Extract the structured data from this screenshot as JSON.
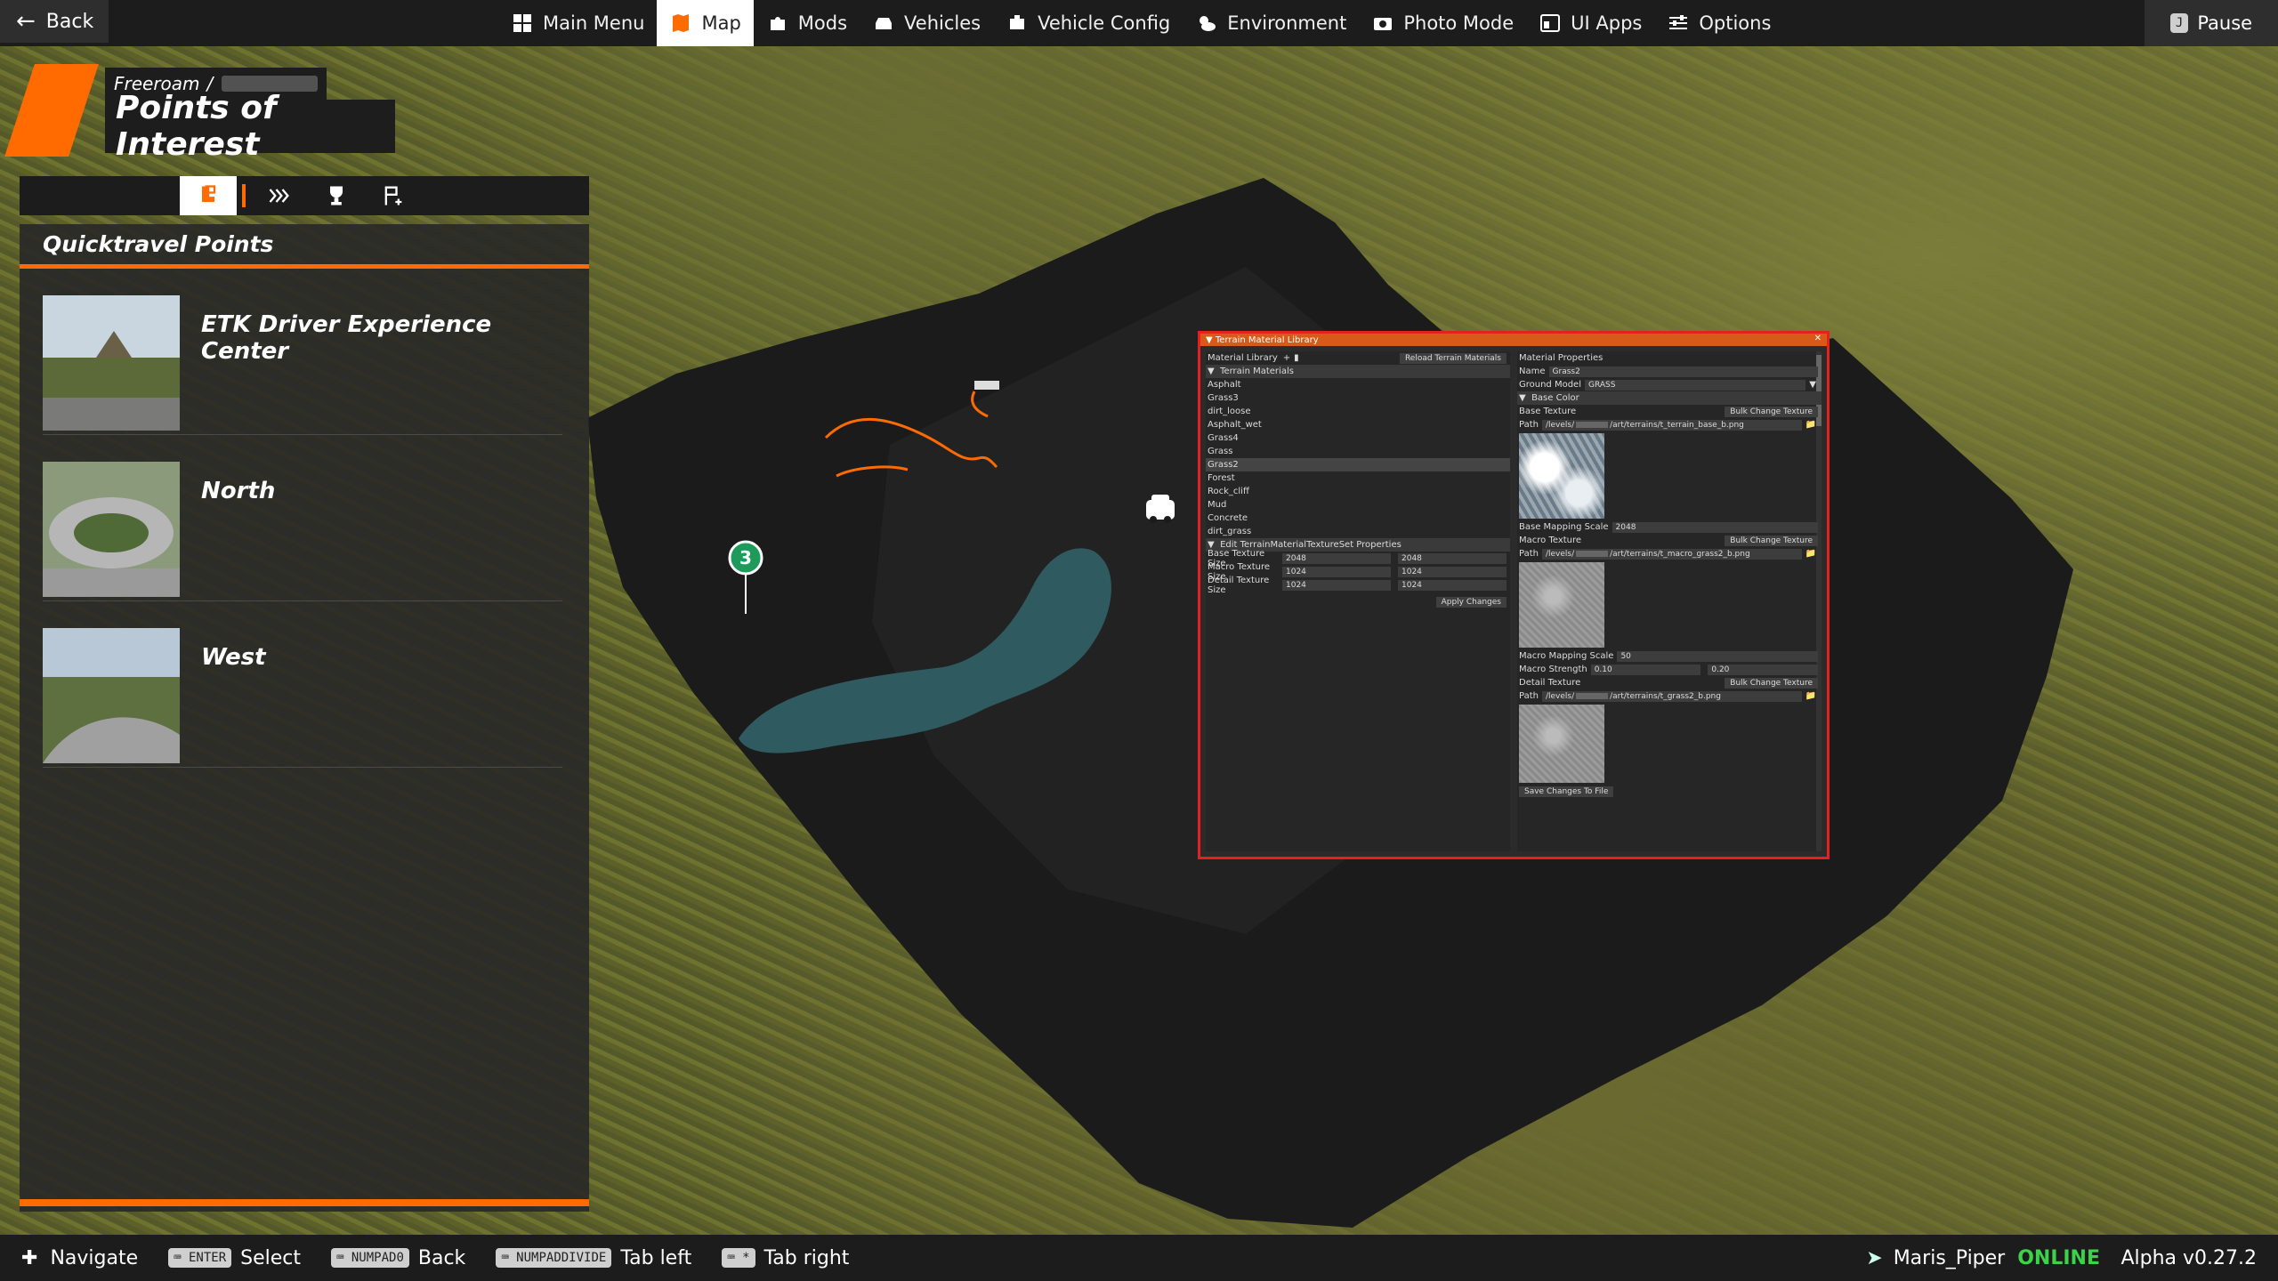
{
  "topbar": {
    "back_label": "Back",
    "nav": [
      {
        "label": "Main Menu",
        "icon": "grid-icon"
      },
      {
        "label": "Map",
        "icon": "map-icon",
        "active": true
      },
      {
        "label": "Mods",
        "icon": "puzzle-icon"
      },
      {
        "label": "Vehicles",
        "icon": "car-icon"
      },
      {
        "label": "Vehicle Config",
        "icon": "engine-icon"
      },
      {
        "label": "Environment",
        "icon": "weather-icon"
      },
      {
        "label": "Photo Mode",
        "icon": "camera-icon"
      },
      {
        "label": "UI Apps",
        "icon": "apps-icon"
      },
      {
        "label": "Options",
        "icon": "sliders-icon"
      }
    ],
    "pause_key": "J",
    "pause_label": "Pause"
  },
  "header": {
    "breadcrumb_root": "Freeroam",
    "breadcrumb_sep": "/",
    "title": "Points of Interest"
  },
  "panel": {
    "heading": "Quicktravel Points",
    "items": [
      {
        "name": "ETK Driver Experience Center"
      },
      {
        "name": "North"
      },
      {
        "name": "West"
      }
    ]
  },
  "map": {
    "marker_number": "3"
  },
  "material_library": {
    "window_title": "Terrain Material Library",
    "library_label": "Material Library",
    "reload_button": "Reload Terrain Materials",
    "terrain_materials_heading": "Terrain Materials",
    "materials": [
      "Asphalt",
      "Grass3",
      "dirt_loose",
      "Asphalt_wet",
      "Grass4",
      "Grass",
      "Grass2",
      "Forest",
      "Rock_cliff",
      "Mud",
      "Concrete",
      "dirt_grass"
    ],
    "selected_material": "Grass2",
    "texture_set_heading": "Edit TerrainMaterialTextureSet Properties",
    "texture_sizes": [
      {
        "label": "Base Texture Size",
        "a": "2048",
        "b": "2048"
      },
      {
        "label": "Macro Texture Size",
        "a": "1024",
        "b": "1024"
      },
      {
        "label": "Detail Texture Size",
        "a": "1024",
        "b": "1024"
      }
    ],
    "apply_button": "Apply Changes",
    "props_heading": "Material Properties",
    "name_label": "Name",
    "name_value": "Grass2",
    "ground_model_label": "Ground Model",
    "ground_model_value": "GRASS",
    "base_color_heading": "Base Color",
    "base_texture_label": "Base Texture",
    "bulk_change_label": "Bulk Change Texture",
    "path_label": "Path",
    "base_texture_path_start": "/levels/",
    "base_texture_path": "/art/terrains/t_terrain_base_b.png",
    "base_mapping_label": "Base Mapping Scale",
    "base_mapping_value": "2048",
    "macro_texture_label": "Macro Texture",
    "macro_texture_path": "/art/terrains/t_macro_grass2_b.png",
    "macro_mapping_label": "Macro Mapping Scale",
    "macro_mapping_value": "50",
    "macro_strength_label": "Macro Strength",
    "macro_strength_a": "0.10",
    "macro_strength_b": "0.20",
    "detail_texture_label": "Detail Texture",
    "detail_texture_path": "/art/terrains/t_grass2_b.png",
    "save_button": "Save Changes To File"
  },
  "bottombar": {
    "hints": [
      {
        "key": "",
        "label": "Navigate"
      },
      {
        "key": "ENTER",
        "label": "Select"
      },
      {
        "key": "NUMPAD0",
        "label": "Back"
      },
      {
        "key": "NUMPADDIVIDE",
        "label": "Tab left"
      },
      {
        "key": "*",
        "label": "Tab right"
      }
    ],
    "username": "Maris_Piper",
    "status": "ONLINE",
    "version": "Alpha v0.27.2"
  },
  "colors": {
    "accent": "#ff6b00",
    "online": "#3cd24a",
    "window_border": "#e62020",
    "water": "#2f5a60"
  }
}
